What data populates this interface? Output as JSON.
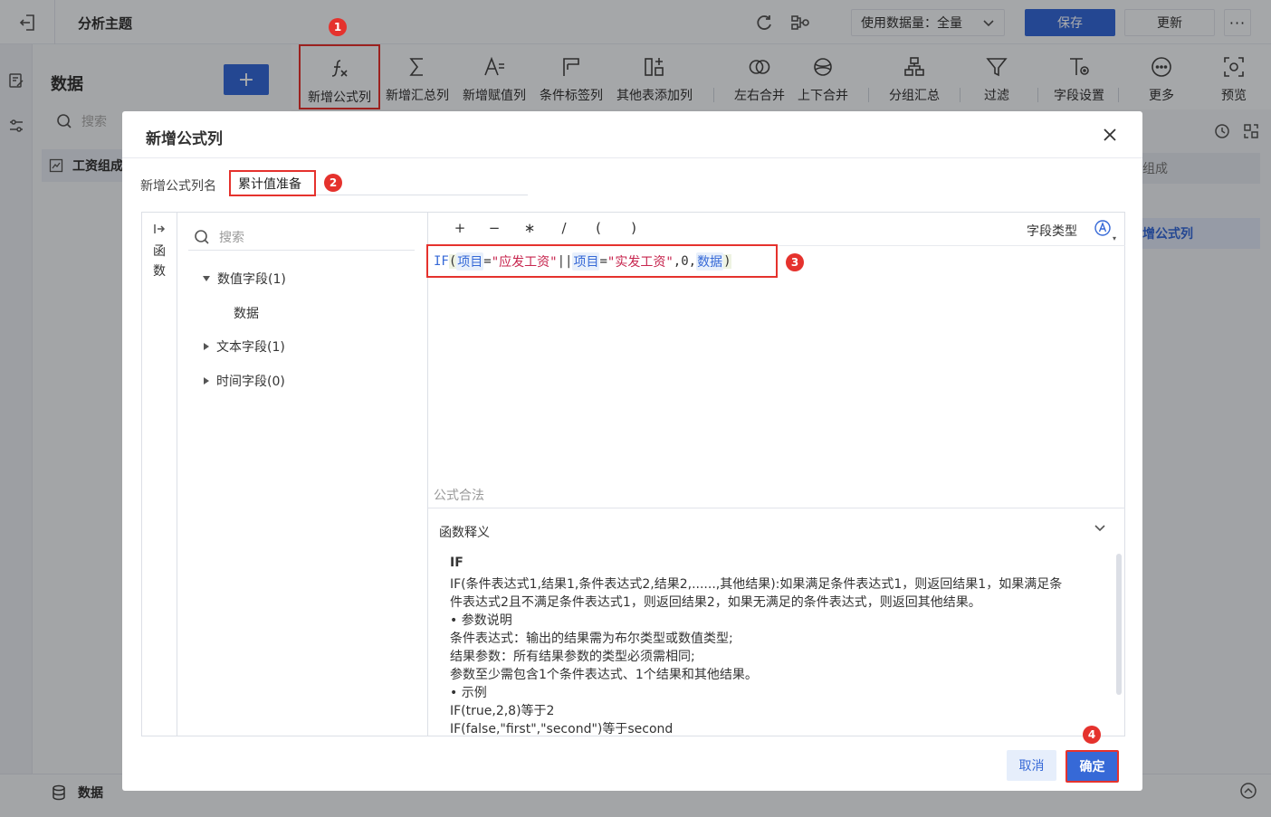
{
  "topbar": {
    "title": "分析主题",
    "usage_label": "使用数据量：全量",
    "save_label": "保存",
    "update_label": "更新",
    "more_label": "···"
  },
  "data_panel": {
    "title": "数据",
    "add_label": "+",
    "search_placeholder": "搜索",
    "table_name": "工资组成"
  },
  "toolbar": {
    "items": [
      {
        "label": "新增公式列",
        "icon": "formula-icon"
      },
      {
        "label": "新增汇总列",
        "icon": "sigma-icon"
      },
      {
        "label": "新增赋值列",
        "icon": "assign-icon"
      },
      {
        "label": "条件标签列",
        "icon": "flag-icon"
      },
      {
        "label": "其他表添加列",
        "icon": "add-column-icon"
      },
      {
        "label": "左右合并",
        "icon": "merge-lr-icon"
      },
      {
        "label": "上下合并",
        "icon": "merge-ud-icon"
      },
      {
        "label": "分组汇总",
        "icon": "group-icon"
      },
      {
        "label": "过滤",
        "icon": "filter-icon"
      },
      {
        "label": "字段设置",
        "icon": "field-settings-icon"
      },
      {
        "label": "更多",
        "icon": "more-icon"
      },
      {
        "label": "预览",
        "icon": "preview-icon"
      }
    ]
  },
  "right_area": {
    "bar1": "组成",
    "bar2": "增公式列"
  },
  "bottom": {
    "tab_label": "数据"
  },
  "dialog": {
    "title": "新增公式列",
    "name_label": "新增公式列名",
    "name_value": "累计值准备",
    "function_rail_label": "函数",
    "search_placeholder": "搜索",
    "tree": {
      "numeric_group": "数值字段(1)",
      "numeric_child": "数据",
      "text_group": "文本字段(1)",
      "time_group": "时间字段(0)"
    },
    "operators": [
      "+",
      "−",
      "∗",
      "/",
      "(",
      ")"
    ],
    "field_type_label": "字段类型",
    "formula": {
      "fn": "IF",
      "open": "(",
      "field1": "项目",
      "eq1": "=",
      "str1": "\"应发工资\"",
      "or": "||",
      "field2": "项目",
      "eq2": "=",
      "str2": "\"实发工资\"",
      "sep1": ",",
      "zero": "0",
      "sep2": ",",
      "field3": "数据",
      "close": ")"
    },
    "validity": "公式合法",
    "explain_title": "函数释义",
    "explain": {
      "fn_name": "IF",
      "lines": [
        "IF(条件表达式1,结果1,条件表达式2,结果2,......,其他结果):如果满足条件表达式1，则返回结果1，如果满足条",
        "件表达式2且不满足条件表达式1，则返回结果2，如果无满足的条件表达式，则返回其他结果。",
        "• 参数说明",
        "条件表达式：输出的结果需为布尔类型或数值类型;",
        "结果参数：所有结果参数的类型必须需相同;",
        "参数至少需包含1个条件表达式、1个结果和其他结果。",
        "• 示例",
        "IF(true,2,8)等于2",
        "IF(false,\"first\",\"second\")等于second"
      ]
    },
    "cancel_label": "取消",
    "confirm_label": "确定"
  },
  "badges": [
    "1",
    "2",
    "3",
    "4"
  ]
}
